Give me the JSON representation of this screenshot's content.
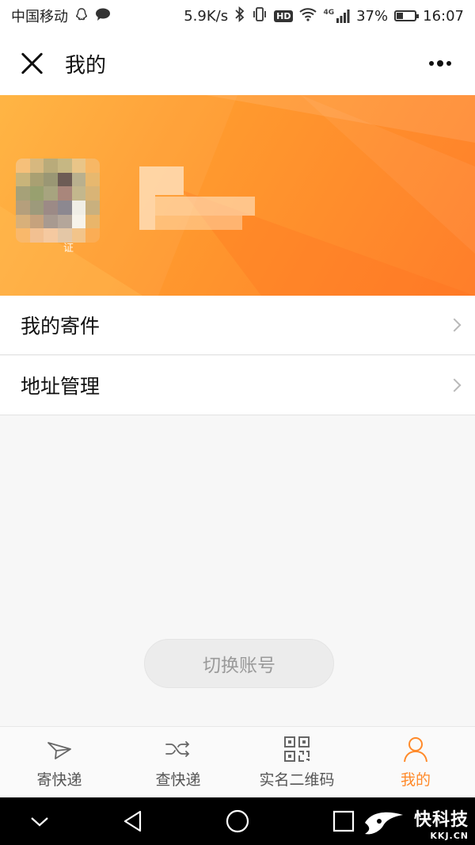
{
  "status_bar": {
    "carrier": "中国移动",
    "speed": "5.9K/s",
    "network": "4G",
    "battery": "37%",
    "battery_level": 0.37,
    "time": "16:07",
    "icons": [
      "qq-icon",
      "chat-bubble-icon",
      "bluetooth-icon",
      "vibrate-icon",
      "hd-icon",
      "wifi-icon",
      "signal-icon",
      "battery-icon"
    ]
  },
  "header": {
    "title": "我的",
    "close_icon": "close-icon",
    "more_icon": "more-icon"
  },
  "profile": {
    "verify_label": "证"
  },
  "menu": [
    {
      "label": "我的寄件"
    },
    {
      "label": "地址管理"
    }
  ],
  "switch_account_label": "切换账号",
  "tabs": [
    {
      "label": "寄快递",
      "icon": "paper-plane-icon"
    },
    {
      "label": "查快递",
      "icon": "shuffle-icon"
    },
    {
      "label": "实名二维码",
      "icon": "qr-code-icon"
    },
    {
      "label": "我的",
      "icon": "user-icon",
      "active": true
    }
  ],
  "nav": [
    "chevron-down-icon",
    "back-icon",
    "home-icon",
    "recents-icon"
  ],
  "watermark": {
    "main": "快科技",
    "sub": "KKJ.CN"
  },
  "colors": {
    "accent": "#ff8a2a",
    "banner_start": "#ffb13a",
    "banner_end": "#ff7e2a"
  }
}
